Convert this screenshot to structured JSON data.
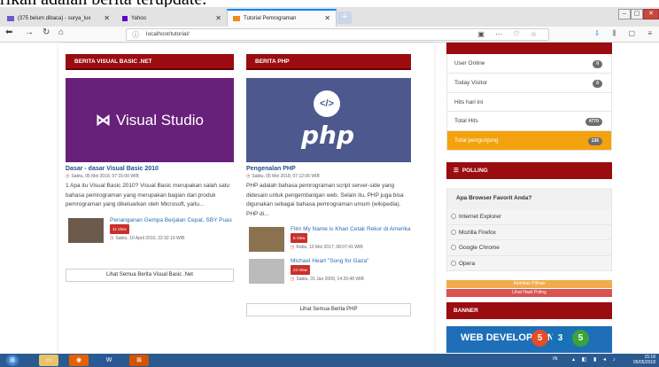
{
  "doc_clip_text": "rikan adalah berita terupdate.",
  "browser": {
    "tabs": [
      {
        "label": "(375 belum dibaca) - surya_lux",
        "active": false
      },
      {
        "label": "Yahoo",
        "active": false
      },
      {
        "label": "Tutorial Pemrograman",
        "active": true
      }
    ],
    "new_tab": "+",
    "url": "localhost/tutorial/",
    "win_min": "–",
    "win_max": "▢",
    "win_close": "✕"
  },
  "columns": [
    {
      "header": "BERITA VISUAL BASIC .NET",
      "hero_text": "Visual Studio",
      "title": "Dasar - dasar Visual Basic 2010",
      "date": "Sabtu, 05 Mei 2018, 07:15:00 WIB",
      "summary": "1 Apa itu Visual Basic 2010? Visual Basic merupakan salah satu bahasa pemrograman  yang merupakan bagian dari produk pemrograman yang dikeluarkan oleh Microsoft, yaitu...",
      "related": [
        {
          "title": "Penanganan Gempa Berjalan Cepat, SBY Puas",
          "views": "11 View",
          "date": "Sabtu, 10 April 2010, 22:32:19 WIB"
        }
      ],
      "more": "Lihat Semua Berita Visual Basic .Net"
    },
    {
      "header": "BERITA PHP",
      "hero_text": "php",
      "hero_symbol": "</>",
      "title": "Pengenalan PHP",
      "date": "Sabtu, 05 Mei 2018, 07:12:06 WIB",
      "summary": "PHP adalah bahasa pemrograman script server-side yang didesain untuk pengembangan web. Selain itu, PHP juga bisa digunakan sebagai bahasa pemrograman umum (wikipedia). PHP di...",
      "related": [
        {
          "title": "Film My Name is Khan Cetak Rekor di Amerika",
          "views": "6 View",
          "date": "Rabu, 10 Mei 2017, 08:07:41 WIB"
        },
        {
          "title": "Michael Heart \"Song for Gaza\"",
          "views": "24 View",
          "date": "Sabtu, 31 Jan 2009, 14:20:48 WIB"
        }
      ],
      "more": "Lihat Semua Berita PHP"
    }
  ],
  "stats": [
    {
      "label": "User Online",
      "value": "0"
    },
    {
      "label": "Today Visitor",
      "value": "0"
    },
    {
      "label": "Hits hari ini",
      "value": ""
    },
    {
      "label": "Total Hits",
      "value": "4770"
    },
    {
      "label": "Total pengunjung",
      "value": "136"
    }
  ],
  "polling": {
    "header": "POLLING",
    "question": "Apa Browser Favorit Anda?",
    "options": [
      "Internet Explorer",
      "Mozilla Firefox",
      "Google Chrome",
      "Opera"
    ],
    "submit": "Kirimkan Pilihan",
    "results": "Lihat Hasil Poling"
  },
  "banner": {
    "header": "BANNER",
    "text": "WEB DEVELOPMENT",
    "badges": [
      "5",
      "3",
      "5"
    ]
  },
  "taskbar": {
    "lang": "IN",
    "time": "15:18",
    "date": "05/05/2018"
  },
  "colors": {
    "brand_red": "#9a0c10",
    "accent_orange": "#f4a20e",
    "link_blue": "#1f4e8c"
  }
}
